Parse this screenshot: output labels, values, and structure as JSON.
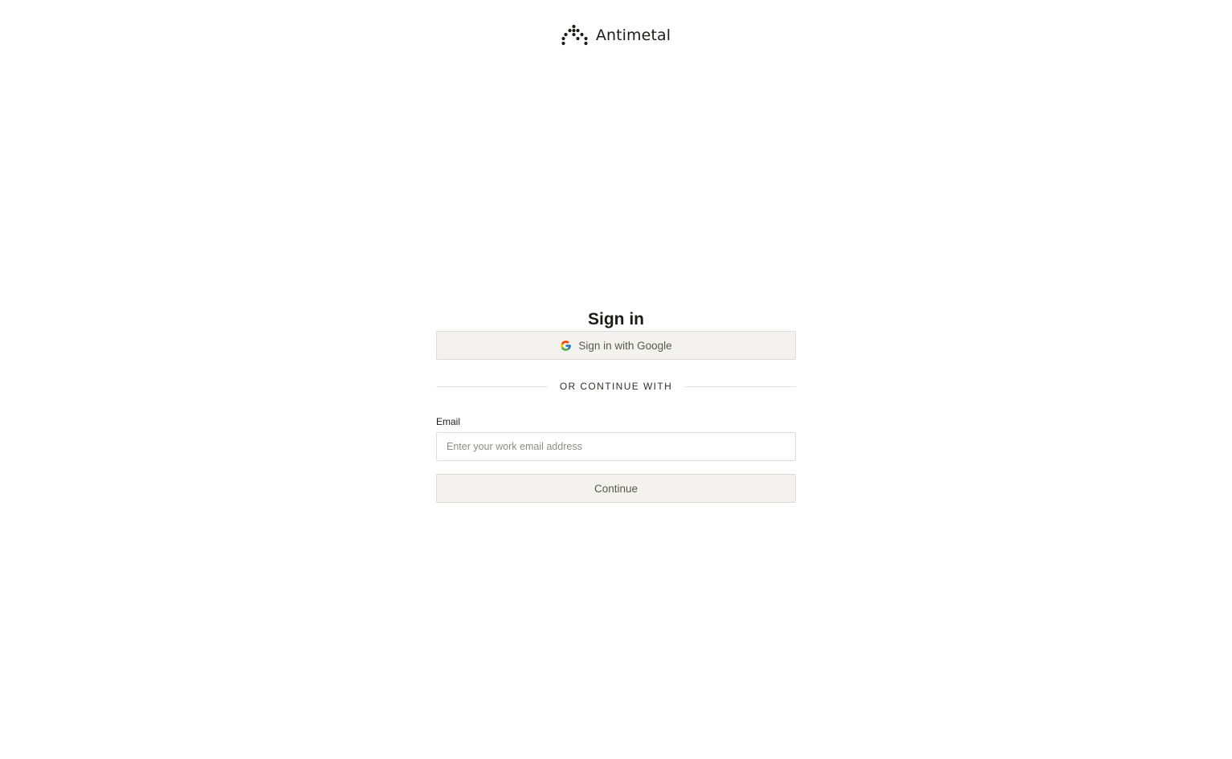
{
  "brand": {
    "name": "Antimetal",
    "logo_icon": "dot-triangle-logo-icon"
  },
  "signin": {
    "title": "Sign in",
    "google_button_label": "Sign in with Google",
    "google_icon": "google-g-icon",
    "divider_text": "OR CONTINUE WITH",
    "email_label": "Email",
    "email_placeholder": "Enter your work email address",
    "email_value": "",
    "continue_label": "Continue"
  },
  "colors": {
    "button_bg": "#f3f2ef",
    "border": "#dcdbd7",
    "text": "#1c1c1a"
  }
}
